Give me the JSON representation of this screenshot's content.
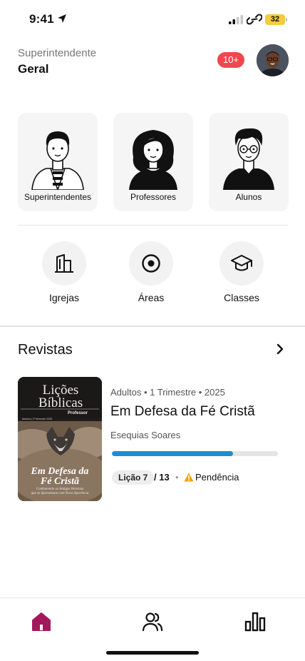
{
  "status_bar": {
    "time": "9:41",
    "battery": "32"
  },
  "header": {
    "role_label": "Superintendente",
    "role_name": "Geral",
    "notifications": "10+"
  },
  "roles": [
    {
      "label": "Superintendentes"
    },
    {
      "label": "Professores"
    },
    {
      "label": "Alunos"
    }
  ],
  "shortcuts": [
    {
      "label": "Igrejas",
      "icon": "building-icon"
    },
    {
      "label": "Áreas",
      "icon": "target-icon"
    },
    {
      "label": "Classes",
      "icon": "graduation-cap-icon"
    }
  ],
  "section": {
    "title": "Revistas"
  },
  "magazine": {
    "cover_title_line1": "Lições",
    "cover_title_line2": "Bíblicas",
    "cover_edition": "Professor",
    "cover_meta": "Adultos | 1º trimestre 2025",
    "cover_subject_line1": "Em Defesa da",
    "cover_subject_line2": "Fé Cristã",
    "cover_tagline_line1": "Combatendo as Antigas Heresias",
    "cover_tagline_line2": "que se Apresentam com Nova Aparência",
    "meta": "Adultos • 1 Trimestre • 2025",
    "title": "Em Defesa da Fé Cristã",
    "author": "Esequias Soares",
    "progress": 0.73,
    "lesson": "Lição 7",
    "lesson_total": "/ 13",
    "dot": "•",
    "pending": "Pendência"
  },
  "colors": {
    "accent": "#a3195b",
    "progress": "#1a8fd0",
    "badge": "#f0474f",
    "warning": "#f2a100"
  },
  "nav": [
    {
      "name": "home",
      "icon": "home-icon",
      "active": true
    },
    {
      "name": "people",
      "icon": "users-icon",
      "active": false
    },
    {
      "name": "reports",
      "icon": "bar-chart-icon",
      "active": false
    }
  ]
}
